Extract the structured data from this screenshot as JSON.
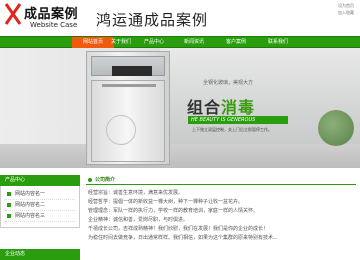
{
  "header": {
    "logo_title": "成品案例",
    "logo_subtitle": "Website Case",
    "site_name": "鸿运通成品案例",
    "top_links": [
      "设为首页",
      "加入收藏"
    ]
  },
  "nav": {
    "items": [
      {
        "label": "网站首页",
        "active": true
      },
      {
        "label": "关于我们",
        "active": false
      },
      {
        "label": "产品中心",
        "active": false
      },
      {
        "label": "新闻资讯",
        "active": false
      },
      {
        "label": "客户案例",
        "active": false
      },
      {
        "label": "联系我们",
        "active": false
      }
    ]
  },
  "banner": {
    "tag": "全钢化玻璃，美观大方",
    "headline_a": "组合",
    "headline_b": "消毒",
    "english": "HE BEAUTY IS GENEROUS",
    "desc": "上下独立双层控制，关上门后立即暂停工作。"
  },
  "sidebar": {
    "title": "产品中心",
    "items": [
      "网站内容名一",
      "网站内容名二",
      "网站内容名三"
    ],
    "title2": "企业动态"
  },
  "main": {
    "title": "公司简介",
    "lines": [
      "经营宗旨：诚善生意环境，满意来优发展。",
      "经营哲学：提倡一体的新收益一棵大树，种下一棵种子让收一盆花卉。",
      "管理理念：军队一样的执行力，学校一样的教育培训，家庭一样的人情关怀。",
      "企业精神：诚信和善，爱岗尽职，与时俱进。",
      "    千禧成长公司，吉祥成熟精神！我们欣慰，我们在发展！我们是你的企业的成长！",
      "为稳住时间去做竞争，日出通常样样。我们相信，如果为这个集群的原来特别有技术..."
    ]
  }
}
